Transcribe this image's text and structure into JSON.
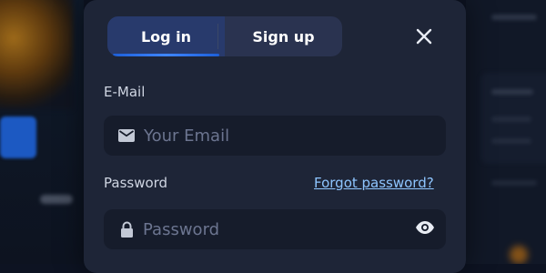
{
  "modal": {
    "tabs": [
      {
        "label": "Log in",
        "active": true
      },
      {
        "label": "Sign up",
        "active": false
      }
    ],
    "email": {
      "label": "E-Mail",
      "placeholder": "Your Email",
      "value": ""
    },
    "password": {
      "label": "Password",
      "placeholder": "Password",
      "value": "",
      "forgot_label": "Forgot password?"
    }
  },
  "icons": {
    "close": "close-icon",
    "email": "envelope-icon",
    "lock": "lock-icon",
    "visibility": "eye-icon"
  },
  "colors": {
    "modal_background": "#1e2537",
    "tab_bar": "#2a3350",
    "tab_active": "#283a6c",
    "accent_blue": "#3f86ff",
    "link": "#8ec5ff",
    "input_background": "#161c2b"
  }
}
